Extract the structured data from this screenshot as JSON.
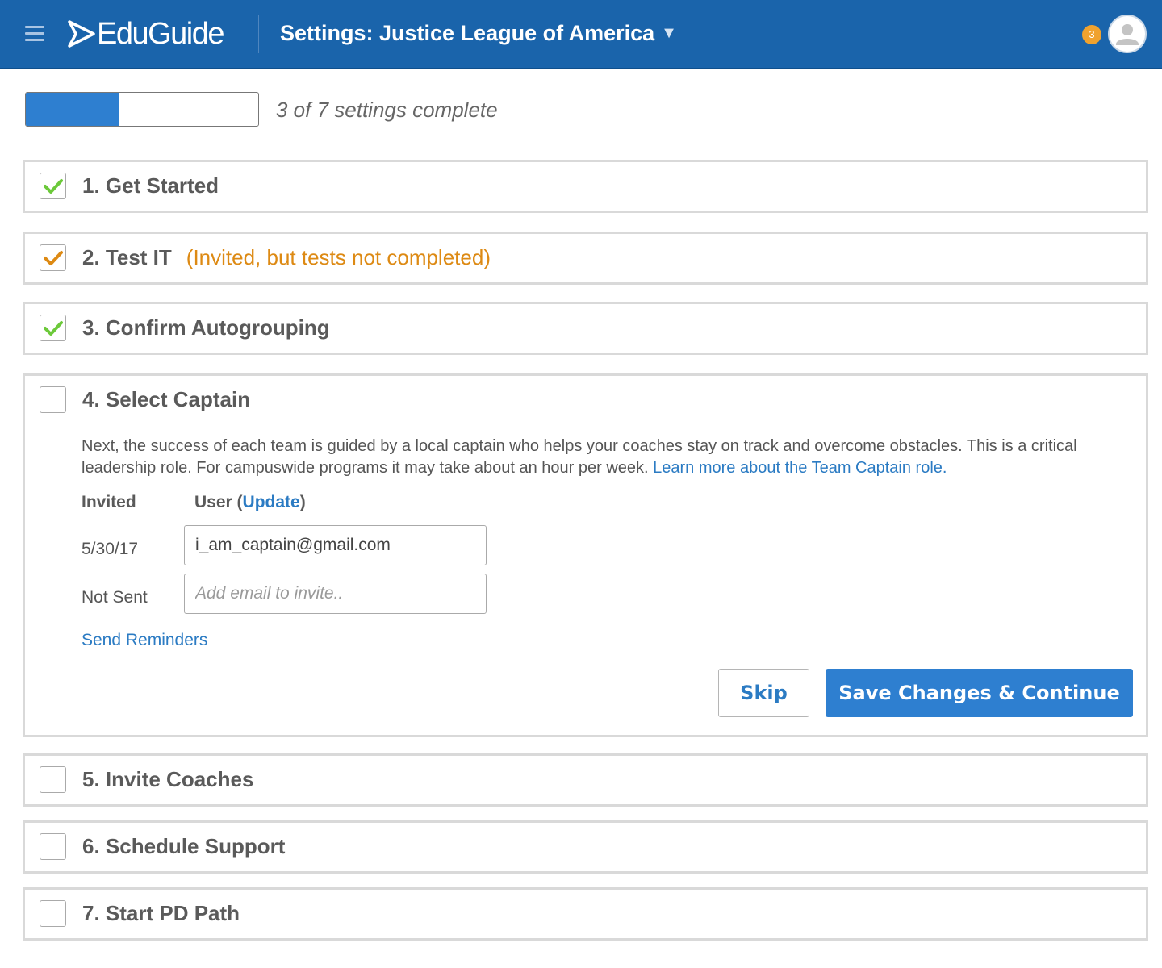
{
  "header": {
    "logo_text": "EduGuide",
    "title": "Settings: Justice League of America",
    "title_caret": "▼",
    "notification_count": "3"
  },
  "progress": {
    "completed": 3,
    "total": 7,
    "fraction": 0.4,
    "label": "3 of 7 settings complete"
  },
  "colors": {
    "header_bg": "#1a64ab",
    "accent": "#2e7fd0",
    "check_green": "#6cc93a",
    "check_orange": "#dd8a14",
    "warning_text": "#dd8a14",
    "badge": "#f0a22e",
    "link": "#2b7bc3"
  },
  "steps": [
    {
      "title": "1. Get Started",
      "status": "complete",
      "icon": "check-green-icon"
    },
    {
      "title": "2. Test IT",
      "status": "partial",
      "icon": "check-orange-icon",
      "note": "(Invited, but tests not completed)"
    },
    {
      "title": "3. Confirm Autogrouping",
      "status": "complete",
      "icon": "check-green-icon"
    },
    {
      "title": "4. Select Captain",
      "status": "open",
      "description": "Next, the success of each team is guided by a local captain who helps your coaches stay on track and overcome obstacles. This is a critical leadership role. For campuswide programs it may take about an hour per week.",
      "learn_more": "Learn more about the Team Captain role.",
      "columns": {
        "invited": "Invited",
        "user_prefix": "User (",
        "update": "Update",
        "user_suffix": ")"
      },
      "rows": [
        {
          "invited": "5/30/17",
          "value": "i_am_captain@gmail.com",
          "placeholder": ""
        },
        {
          "invited": "Not Sent",
          "value": "",
          "placeholder": "Add email to invite.."
        }
      ],
      "send_reminders": "Send Reminders",
      "skip_label": "Skip",
      "save_label": "Save Changes & Continue"
    },
    {
      "title": "5. Invite Coaches",
      "status": "incomplete"
    },
    {
      "title": "6. Schedule Support",
      "status": "incomplete"
    },
    {
      "title": "7. Start PD Path",
      "status": "incomplete"
    }
  ]
}
